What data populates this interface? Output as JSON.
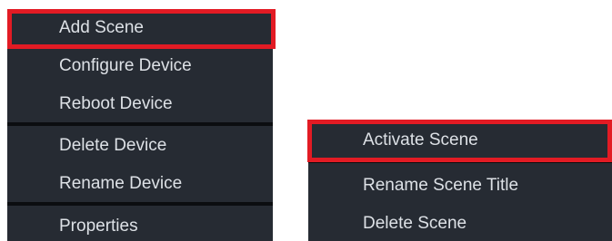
{
  "device_menu": {
    "items": [
      {
        "label": "Add Scene",
        "highlighted": true
      },
      {
        "label": "Configure Device"
      },
      {
        "label": "Reboot Device"
      },
      {
        "label": "Delete Device"
      },
      {
        "label": "Rename Device"
      },
      {
        "label": "Properties"
      }
    ]
  },
  "scene_menu": {
    "items": [
      {
        "label": "Activate Scene",
        "highlighted": true
      },
      {
        "label": "Rename Scene Title"
      },
      {
        "label": "Delete Scene"
      }
    ]
  },
  "colors": {
    "menu_background": "#262b33",
    "menu_text": "#dde1e6",
    "separator": "#0b0d10",
    "highlight_border": "#e21b24"
  }
}
